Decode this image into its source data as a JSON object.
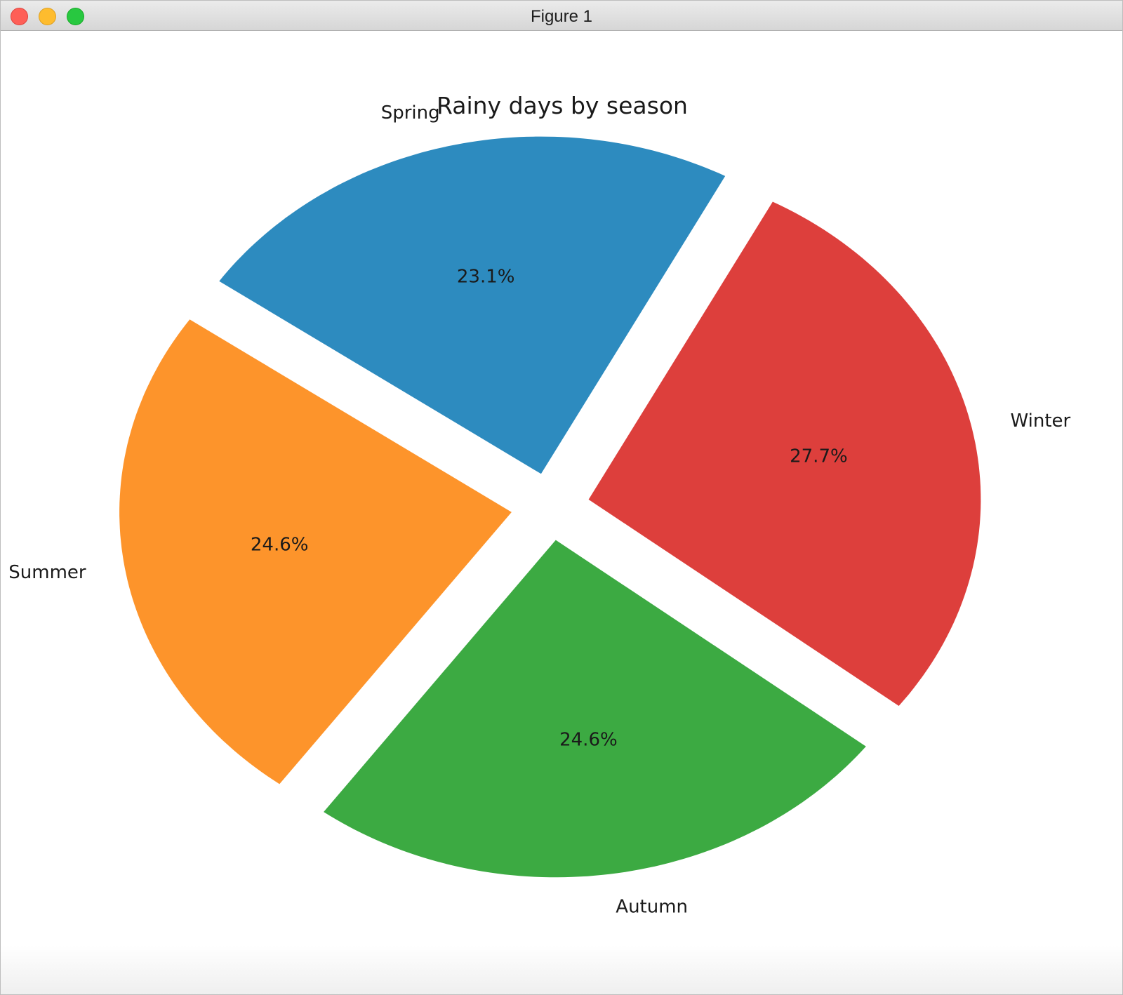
{
  "window": {
    "title": "Figure 1"
  },
  "chart_data": {
    "type": "pie",
    "title": "Rainy days by season",
    "labels": [
      "Spring",
      "Summer",
      "Autumn",
      "Winter"
    ],
    "values": [
      23.1,
      24.6,
      24.6,
      27.7
    ],
    "autopct": [
      "23.1%",
      "24.6%",
      "24.6%",
      "27.7%"
    ],
    "colors": [
      "#2d8bbf",
      "#fd942b",
      "#3caa42",
      "#dd3f3c"
    ],
    "exploded": true,
    "start_angle_deg": 62,
    "direction": "counterclockwise"
  }
}
